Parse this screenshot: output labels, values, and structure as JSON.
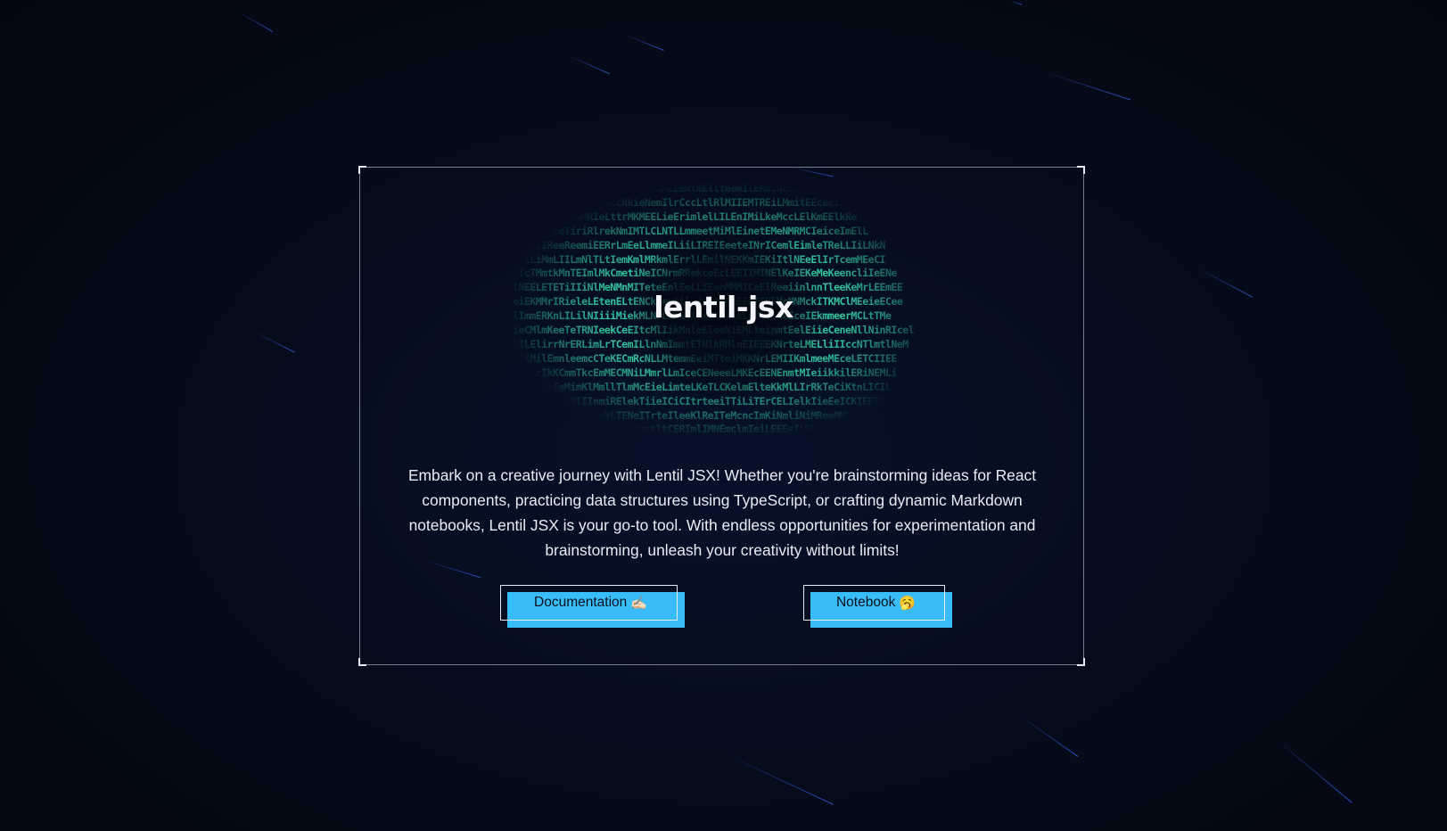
{
  "title": "lentil-jsx",
  "description": "Embark on a creative journey with Lentil JSX! Whether you're brainstorming ideas for React components, practicing data structures using TypeScript, or crafting dynamic Markdown notebooks, Lentil JSX is your go-to tool. With endless opportunities for experimentation and brainstorming, unleash your creativity without limits!",
  "buttons": {
    "documentation": {
      "label": "Documentation",
      "emoji": "✍🏻"
    },
    "notebook": {
      "label": "Notebook",
      "emoji": "🥱"
    }
  },
  "matrix_lines": [
    "LNeeNciRMLlMmKLRLEKmILlteNMLLeRtmEllteemIlEMkCnELeElNeeLE",
    "NiiNNmIeENrKTETKmlcRkieNemIlrCccLtlRlMIIEMTREiLMmitEEceeIN",
    "LilLNMeeEmcmMRIeLttrMKMEELieErimlelLILEnIMiLkeMccLElKmEElkRe",
    "EtimEMkteTiriRlrekNmIMTLCLNTLLmmeetMiMlEinetEMeNMRMCIeiceImElL",
    "eiLiLIReeReemiEERrLmEeLlmmeILiiLIREIEeeteINrICemlEimleTReLLIiLNkN",
    "mrILiMmLIILmNlTLtIemKmlMRkmlErrlLEmilNEKKmIEKiItlNEeElIrTcemMEeCI",
    "lTcTMmtkMnTEImlMkCmetiNeICNrmRRekceEcLEEIIMINElKeIEKeMeKeencliIeENe",
    "lNEELETETiIIiNlMeNMnMITeteEnlEeLLIEenMMMICeElReeiinlnnTleeKeMrLEEmEE",
    "eiEKMMrIRieleLEtenELtENCkLentil-jsxmmeeEEeITNlMcMNMckITKMClMEeieECee",
    "lImmERKnLILilNIiiiMiekMLNrLiKelIEmCMMIleLrRIceIeEceIEkmmeerMCLtTMe",
    "ieCMlmKeeTeTRNIeekCeEItcMlIikMnleEleeNiEMLteinmtEelEiieCeneNllNinRIcel",
    "lILElirrNrERLimLrTCemILlnNmImmtETNlkRMlnEIEEEKNrteLMELliIIccNTlmtlNeM",
    "mCiMilEmnleemcCTeKECmRcNLLMtemmEeiMTteiMKKNrLEMIIKmlmeeMEceLETCIIEE",
    "lTEirIkKCmmTkcEmMECMNiLMmrlLmIceCENeeeLMKEcEENEnmtMIeiikkilERiNEMLi",
    "lmkktNlEeMimKlMmllTlmMcEieLimteLKeTLCKelmElteKkMlLIrRkTeCiKtnLICIL",
    "eiiMMrMRLmMlIInmiRElekTiieICiCItrteeiTTiLiTErCELIelkIieEeICKIEEEL",
    "MNCNLNktriNNITkekLTENeITrteIleeKlReITeMcncImKiNmliNiMReeMMLtELTNe",
    "mLiEimREiIliKNEcmLlenemrtltCERImlIMNEmclmIeiLEEEeILRkeCLeLETKM"
  ]
}
